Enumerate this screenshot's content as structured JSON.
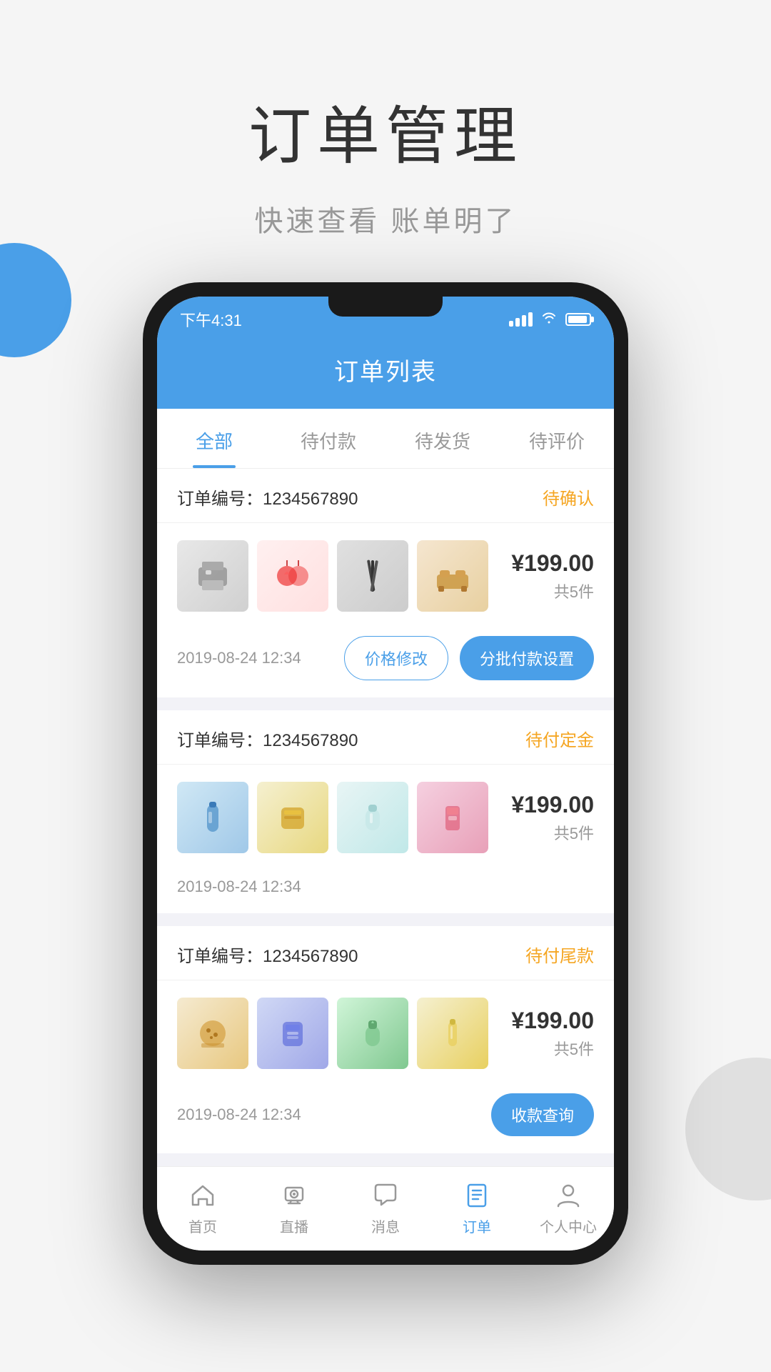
{
  "hero": {
    "title": "订单管理",
    "subtitle": "快速查看  账单明了"
  },
  "phone": {
    "status_bar": {
      "time": "下午4:31"
    },
    "header": {
      "title": "订单列表"
    },
    "tabs": [
      {
        "label": "全部",
        "active": true
      },
      {
        "label": "待付款",
        "active": false
      },
      {
        "label": "待发货",
        "active": false
      },
      {
        "label": "待评价",
        "active": false
      }
    ],
    "orders": [
      {
        "number_label": "订单编号：",
        "number": "1234567890",
        "status": "待确认",
        "price": "¥199.00",
        "count": "共5件",
        "date": "2019-08-24 12:34",
        "actions": [
          {
            "label": "价格修改",
            "type": "outline"
          },
          {
            "label": "分批付款设置",
            "type": "fill"
          }
        ],
        "products": [
          "printer",
          "decor",
          "pens",
          "furniture"
        ]
      },
      {
        "number_label": "订单编号：",
        "number": "1234567890",
        "status": "待付定金",
        "price": "¥199.00",
        "count": "共5件",
        "date": "2019-08-24 12:34",
        "actions": [],
        "products": [
          "bottle",
          "snack",
          "cream",
          "cosmetic"
        ]
      },
      {
        "number_label": "订单编号：",
        "number": "1234567890",
        "status": "待付尾款",
        "price": "¥199.00",
        "count": "共5件",
        "date": "2019-08-24 12:34",
        "actions": [
          {
            "label": "收款查询",
            "type": "fill"
          }
        ],
        "products": [
          "cookie",
          "medicine",
          "lotion",
          "serum"
        ]
      }
    ],
    "bottom_nav": [
      {
        "label": "首页",
        "icon": "home",
        "active": false
      },
      {
        "label": "直播",
        "icon": "live",
        "active": false
      },
      {
        "label": "消息",
        "icon": "message",
        "active": false
      },
      {
        "label": "订单",
        "icon": "order",
        "active": true
      },
      {
        "label": "个人中心",
        "icon": "user",
        "active": false
      }
    ]
  }
}
